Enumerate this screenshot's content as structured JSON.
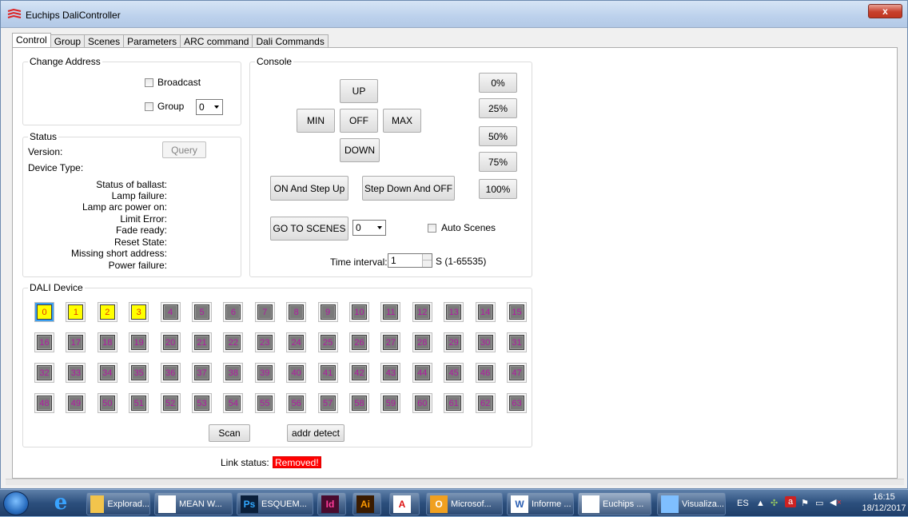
{
  "window": {
    "title": "Euchips DaliController",
    "close_label": "x"
  },
  "tabs": [
    "Control",
    "Group",
    "Scenes",
    "Parameters",
    "ARC command",
    "Dali Commands"
  ],
  "change_address": {
    "title": "Change Address",
    "broadcast_label": "Broadcast",
    "group_label": "Group",
    "group_value": "0"
  },
  "status": {
    "title": "Status",
    "version_label": "Version:",
    "query_label": "Query",
    "device_type_label": "Device Type:",
    "rows": [
      "Status of ballast:",
      "Lamp failure:",
      "Lamp arc power on:",
      "Limit Error:",
      "Fade ready:",
      "Reset State:",
      "Missing short address:",
      "Power failure:"
    ]
  },
  "console": {
    "title": "Console",
    "up": "UP",
    "min": "MIN",
    "off": "OFF",
    "max": "MAX",
    "down": "DOWN",
    "p0": "0%",
    "p25": "25%",
    "p50": "50%",
    "p75": "75%",
    "p100": "100%",
    "on_step_up": "ON And Step Up",
    "step_down_off": "Step Down And OFF",
    "go_scenes": "GO TO SCENES",
    "scene_value": "0",
    "auto_scenes": "Auto Scenes",
    "time_interval_label": "Time interval:",
    "time_interval_value": "1",
    "time_range": "S (1-65535)"
  },
  "dali": {
    "title": "DALI Device",
    "devices": [
      "0",
      "1",
      "2",
      "3",
      "4",
      "5",
      "6",
      "7",
      "8",
      "9",
      "10",
      "11",
      "12",
      "13",
      "14",
      "15",
      "16",
      "17",
      "18",
      "19",
      "20",
      "21",
      "22",
      "23",
      "24",
      "25",
      "26",
      "27",
      "28",
      "29",
      "30",
      "31",
      "32",
      "33",
      "34",
      "35",
      "36",
      "37",
      "38",
      "39",
      "40",
      "41",
      "42",
      "43",
      "44",
      "45",
      "46",
      "47",
      "48",
      "49",
      "50",
      "51",
      "52",
      "53",
      "54",
      "55",
      "56",
      "57",
      "58",
      "59",
      "60",
      "61",
      "62",
      "63"
    ],
    "active": [
      "0",
      "1",
      "2",
      "3"
    ],
    "selected": "0",
    "scan": "Scan",
    "addr_detect": "addr detect"
  },
  "link": {
    "label": "Link status:",
    "value": "Removed!"
  },
  "taskbar": {
    "items": [
      {
        "label": "Explorad...",
        "icon": "folder-icon",
        "color": "#f2c44c",
        "glyph": ""
      },
      {
        "label": "MEAN W...",
        "icon": "chrome-icon",
        "color": "#ffffff",
        "glyph": ""
      },
      {
        "label": "ESQUEM...",
        "icon": "photoshop-icon",
        "color": "#0a1f3a",
        "glyph": "Ps"
      },
      {
        "label": "",
        "icon": "indesign-icon",
        "color": "#4a0b2e",
        "glyph": "Id"
      },
      {
        "label": "",
        "icon": "illustrator-icon",
        "color": "#3a1b00",
        "glyph": "Ai"
      },
      {
        "label": "",
        "icon": "acrobat-icon",
        "color": "#ffffff",
        "glyph": "A"
      },
      {
        "label": "Microsof...",
        "icon": "outlook-icon",
        "color": "#f0a020",
        "glyph": "O"
      },
      {
        "label": "Informe ...",
        "icon": "word-icon",
        "color": "#ffffff",
        "glyph": "W"
      },
      {
        "label": "Euchips ...",
        "icon": "euchips-icon",
        "color": "#ffffff",
        "glyph": ""
      },
      {
        "label": "Visualiza...",
        "icon": "photo-viewer-icon",
        "color": "#7fbfff",
        "glyph": ""
      }
    ],
    "lang": "ES",
    "time": "16:15",
    "date": "18/12/2017"
  }
}
